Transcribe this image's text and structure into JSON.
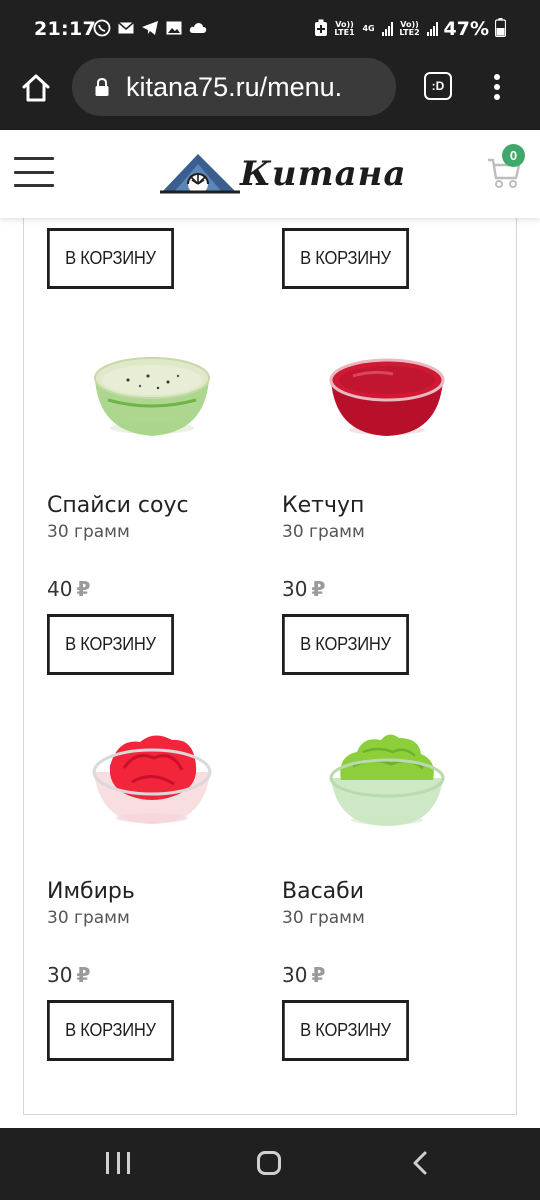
{
  "status_bar": {
    "time": "21:17",
    "net1": "Vo)) LTE1",
    "net_4g": "4G",
    "net2": "Vo)) LTE2",
    "battery": "47%"
  },
  "browser": {
    "url": "kitana75.ru/menu.",
    "tabs_label": ":D"
  },
  "site": {
    "logo_text": "Китана",
    "cart_count": "0",
    "accent_color": "#3fa86b"
  },
  "cart_button_label": "В КОРЗИНУ",
  "currency": "₽",
  "products": [
    {
      "name": "Спайси соус",
      "weight": "30 грамм",
      "price": "40",
      "image": "spicy-sauce-bowl"
    },
    {
      "name": "Кетчуп",
      "weight": "30 грамм",
      "price": "30",
      "image": "ketchup-bowl"
    },
    {
      "name": "Имбирь",
      "weight": "30 грамм",
      "price": "30",
      "image": "ginger-bowl"
    },
    {
      "name": "Васаби",
      "weight": "30 грамм",
      "price": "30",
      "image": "wasabi-bowl"
    }
  ]
}
